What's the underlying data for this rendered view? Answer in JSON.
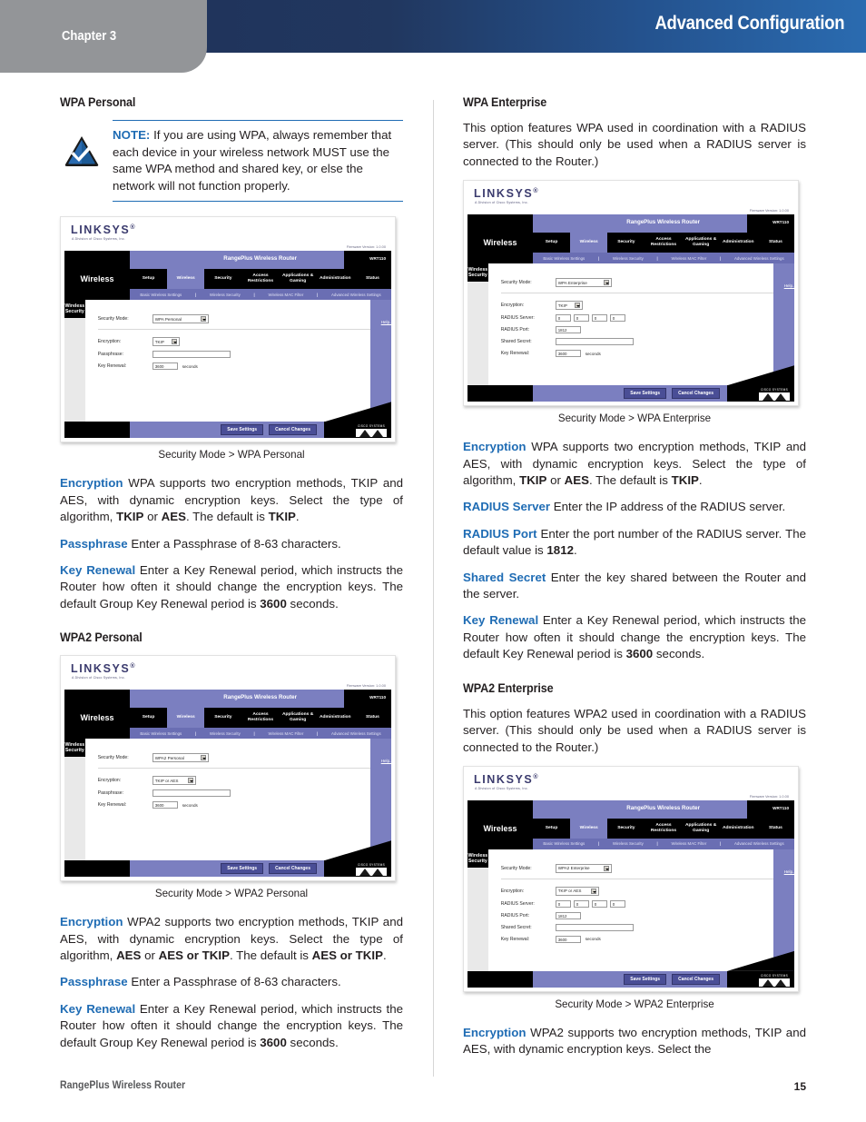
{
  "header": {
    "chapter": "Chapter 3",
    "title": "Advanced Configuration",
    "gradient_start": "#20345c",
    "gradient_end": "#2a6bb0",
    "tab_color": "#939598"
  },
  "accent_color": "#1f6cb4",
  "left_column": {
    "heading_wpa_personal": "WPA Personal",
    "note": {
      "lead": "NOTE:",
      "text": " If you are using WPA, always remember that each device in your wireless network MUST use the same WPA method and shared key, or else the network will not function properly."
    },
    "figure1_caption": "Security Mode > WPA Personal",
    "para_encryption": {
      "term": "Encryption",
      "text_1": "  WPA supports two encryption methods, TKIP and AES, with dynamic encryption keys. Select the type of algorithm, ",
      "bold_1": "TKIP",
      "text_2": " or ",
      "bold_2": "AES",
      "text_3": ". The default is ",
      "bold_3": "TKIP",
      "text_4": "."
    },
    "para_passphrase": {
      "term": "Passphrase",
      "text": "  Enter a Passphrase of 8-63 characters."
    },
    "para_keyrenewal": {
      "term": "Key Renewal",
      "text_1": "  Enter a Key Renewal period, which instructs the Router how often it should change the encryption keys. The default Group Key Renewal period is ",
      "bold_1": "3600",
      "text_2": " seconds."
    },
    "heading_wpa2_personal": "WPA2 Personal",
    "figure2_caption": "Security Mode > WPA2 Personal",
    "para_encryption2": {
      "term": "Encryption",
      "text_1": " WPA2 supports two encryption methods, TKIP and AES, with dynamic encryption keys. Select the type of algorithm, ",
      "bold_1": "AES",
      "text_2": " or ",
      "bold_2": "AES or TKIP",
      "text_3": ". The default is ",
      "bold_3": "AES or TKIP",
      "text_4": "."
    },
    "para_passphrase2": {
      "term": "Passphrase",
      "text": "  Enter a Passphrase of 8-63 characters."
    },
    "para_keyrenewal2": {
      "term": "Key Renewal",
      "text_1": "  Enter a Key Renewal period, which instructs the Router how often it should change the encryption keys. The default Group Key Renewal period is ",
      "bold_1": "3600",
      "text_2": " seconds."
    }
  },
  "right_column": {
    "heading_wpa_enterprise": "WPA Enterprise",
    "intro_wpa_enterprise": "This option features WPA used in coordination with a RADIUS server. (This should only be used when a RADIUS server is connected to the Router.)",
    "figure3_caption": "Security Mode > WPA Enterprise",
    "para_encryption": {
      "term": "Encryption",
      "text_1": "  WPA supports two encryption methods, TKIP and AES, with dynamic encryption keys. Select the type of algorithm, ",
      "bold_1": "TKIP",
      "text_2": " or ",
      "bold_2": "AES",
      "text_3": ". The default is ",
      "bold_3": "TKIP",
      "text_4": "."
    },
    "para_radius_server": {
      "term": "RADIUS Server",
      "text": " Enter the IP address of the RADIUS server."
    },
    "para_radius_port": {
      "term": "RADIUS Port",
      "text_1": "  Enter the port number of the RADIUS server. The default value is ",
      "bold_1": "1812",
      "text_2": "."
    },
    "para_shared_secret": {
      "term": "Shared Secret",
      "text": "  Enter the key shared between the Router and the server."
    },
    "para_key_renewal": {
      "term": "Key Renewal",
      "text_1": "  Enter a Key Renewal period, which instructs the Router how often it should change the encryption keys. The default Key Renewal period is ",
      "bold_1": "3600",
      "text_2": " seconds."
    },
    "heading_wpa2_enterprise": "WPA2 Enterprise",
    "intro_wpa2_enterprise": "This option features WPA2 used in coordination with a RADIUS server. (This should only be used when a RADIUS server is connected to the Router.)",
    "figure4_caption": "Security Mode > WPA2 Enterprise",
    "para_encryption_last": {
      "term": "Encryption",
      "text": " WPA2 supports two encryption methods, TKIP and AES, with dynamic encryption keys. Select the"
    }
  },
  "router_ui": {
    "brand": "LINKSYS",
    "brand_tm": "®",
    "brand_sub": "A Division of Cisco Systems, Inc.",
    "firmware": "Firmware Version: 1.0.00",
    "model_name": "RangePlus Wireless Router",
    "model_number": "WRT110",
    "page_title": "Wireless",
    "tabs": [
      "Setup",
      "Wireless",
      "Security",
      "Access Restrictions",
      "Applications & Gaming",
      "Administration",
      "Status"
    ],
    "active_tab": "Wireless",
    "subtabs": [
      "Basic Wireless Settings",
      "Wireless Security",
      "Wireless MAC Filter",
      "Advanced Wireless Settings"
    ],
    "side_label": "Wireless Security",
    "help_link": "Help...",
    "save_button": "Save Settings",
    "cancel_button": "Cancel Changes",
    "cisco_word": "CISCO SYSTEMS",
    "labels": {
      "security_mode": "Security Mode:",
      "encryption": "Encryption:",
      "passphrase": "Passphrase:",
      "key_renewal": "Key Renewal:",
      "radius_server": "RADIUS Server:",
      "radius_port": "RADIUS Port:",
      "shared_secret": "Shared Secret:",
      "seconds": "seconds"
    },
    "screens": {
      "wpa_personal": {
        "security_mode": "WPA Personal",
        "encryption": "TKIP",
        "passphrase": "",
        "key_renewal": "3600"
      },
      "wpa2_personal": {
        "security_mode": "WPA2 Personal",
        "encryption": "TKIP or AES",
        "passphrase": "",
        "key_renewal": "3600"
      },
      "wpa_enterprise": {
        "security_mode": "WPA Enterprise",
        "encryption": "TKIP",
        "radius_server": [
          "0",
          "0",
          "0",
          "0"
        ],
        "radius_port": "1812",
        "shared_secret": "",
        "key_renewal": "3600"
      },
      "wpa2_enterprise": {
        "security_mode": "WPA2 Enterprise",
        "encryption": "TKIP or AES",
        "radius_server": [
          "0",
          "0",
          "0",
          "0"
        ],
        "radius_port": "1812",
        "shared_secret": "",
        "key_renewal": "3600"
      }
    }
  },
  "footer": {
    "left": "RangePlus Wireless Router",
    "page_number": "15"
  }
}
